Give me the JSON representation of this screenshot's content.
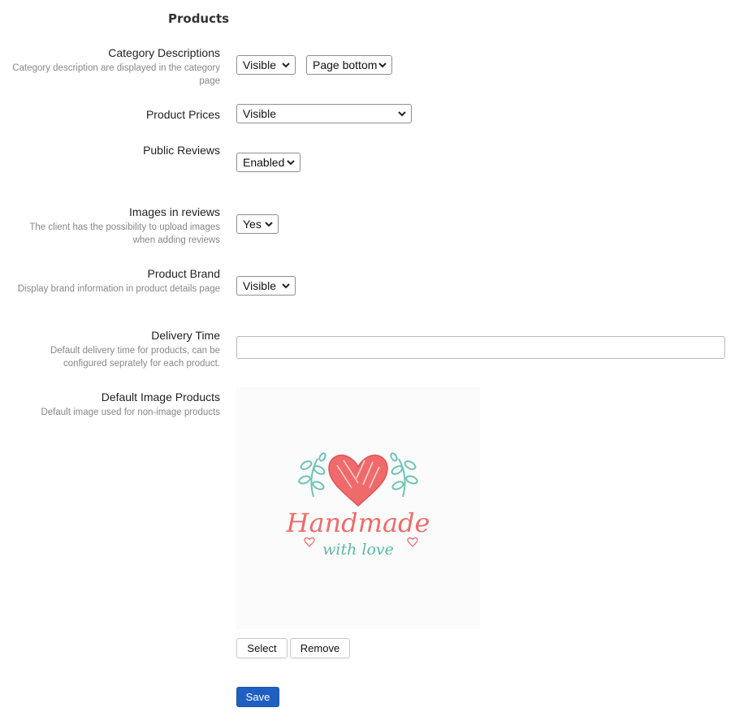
{
  "section": {
    "title": "Products"
  },
  "category_descriptions": {
    "label": "Category Descriptions",
    "desc": "Category description are displayed in the category page",
    "visibility": "Visible",
    "position": "Page bottom"
  },
  "product_prices": {
    "label": "Product Prices",
    "value": "Visible"
  },
  "public_reviews": {
    "label": "Public Reviews",
    "value": "Enabled"
  },
  "images_in_reviews": {
    "label": "Images in reviews",
    "desc": "The client has the possibility to upload images when adding reviews",
    "value": "Yes"
  },
  "product_brand": {
    "label": "Product Brand",
    "desc": "Display brand information in product details page",
    "value": "Visible"
  },
  "delivery_time": {
    "label": "Delivery Time",
    "desc": "Default delivery time for products, can be configured seprately for each product.",
    "value": ""
  },
  "default_image": {
    "label": "Default Image Products",
    "desc": "Default image used for non-image products",
    "logo_text_main": "Handmade",
    "logo_text_sub": "with love",
    "colors": {
      "heart": "#ef6b6b",
      "leaf": "#6ec4b4",
      "text_main": "#ef6b6b",
      "text_sub": "#5cb8a7"
    }
  },
  "buttons": {
    "select": "Select",
    "remove": "Remove",
    "save": "Save"
  },
  "colors": {
    "primary": "#1f5fc4"
  }
}
